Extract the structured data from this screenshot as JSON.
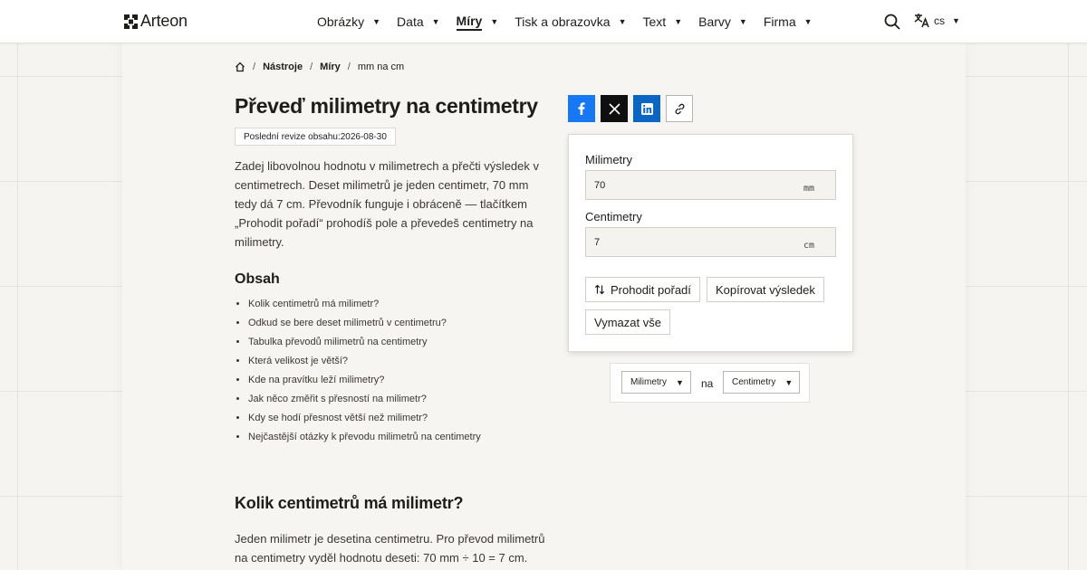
{
  "brand": {
    "name": "Arteon"
  },
  "nav": {
    "items": [
      {
        "label": "Obrázky",
        "active": false
      },
      {
        "label": "Data",
        "active": false
      },
      {
        "label": "Míry",
        "active": true
      },
      {
        "label": "Tisk a obrazovka",
        "active": false
      },
      {
        "label": "Text",
        "active": false
      },
      {
        "label": "Barvy",
        "active": false
      },
      {
        "label": "Firma",
        "active": false
      }
    ],
    "search_icon": "search-icon",
    "language": {
      "icon": "translate-icon",
      "code": "cs"
    }
  },
  "breadcrumb": {
    "home_icon": "home-icon",
    "items": [
      "Nástroje",
      "Míry",
      "mm na cm"
    ]
  },
  "page": {
    "title": "Převeď milimetry na centimetry",
    "revision": "Poslední revize obsahu:2026-08-30",
    "intro": "Zadej libovolnou hodnotu v milimetrech a přečti výsledek v centimetrech. Deset milimetrů je jeden centimetr, 70 mm tedy dá 7 cm. Převodník funguje i obráceně — tlačítkem „Prohodit pořadí“ prohodíš pole a převedeš centimetry na milimetry."
  },
  "toc": {
    "title": "Obsah",
    "items": [
      "Kolik centimetrů má milimetr?",
      "Odkud se bere deset milimetrů v centimetru?",
      "Tabulka převodů milimetrů na centimetry",
      "Která velikost je větší?",
      "Kde na pravítku leží milimetry?",
      "Jak něco změřit s přesností na milimetr?",
      "Kdy se hodí přesnost větší než milimetr?",
      "Nejčastější otázky k převodu milimetrů na centimetry"
    ]
  },
  "section": {
    "heading": "Kolik centimetrů má milimetr?",
    "text": "Jeden milimetr je desetina centimetru. Pro převod milimetrů na centimetry vyděl hodnotu deseti: 70 mm ÷ 10 = 7 cm."
  },
  "share": {
    "icons": [
      "facebook-icon",
      "x-icon",
      "linkedin-icon",
      "link-icon"
    ],
    "colors": {
      "facebook": "#1877f2",
      "x": "#0f0f0f",
      "linkedin": "#0a66c2"
    }
  },
  "converter": {
    "from": {
      "label": "Milimetry",
      "value": "70",
      "unit": "mm"
    },
    "to": {
      "label": "Centimetry",
      "value": "7",
      "unit": "cm"
    },
    "buttons": {
      "swap": "Prohodit pořadí",
      "copy": "Kopírovat výsledek",
      "clear": "Vymazat vše"
    }
  },
  "units": {
    "from": "Milimetry",
    "connector": "na",
    "to": "Centimetry"
  }
}
